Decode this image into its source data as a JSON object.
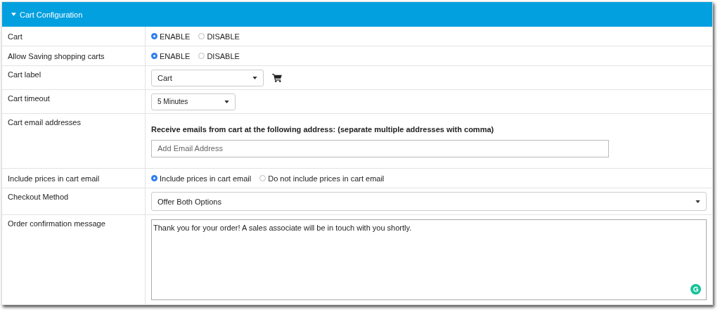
{
  "panel": {
    "title": "Cart Configuration",
    "expanded": true
  },
  "rows": [
    {
      "label": "Cart",
      "kind": "radio",
      "options": [
        {
          "label": "ENABLE",
          "selected": true
        },
        {
          "label": "DISABLE",
          "selected": false
        }
      ]
    },
    {
      "label": "Allow Saving shopping carts",
      "kind": "radio",
      "options": [
        {
          "label": "ENABLE",
          "selected": true
        },
        {
          "label": "DISABLE",
          "selected": false
        }
      ]
    },
    {
      "label": "Cart label",
      "kind": "select",
      "value": "Cart",
      "cart_icon": true
    },
    {
      "label": "Cart timeout",
      "kind": "select",
      "value": "5 Minutes"
    },
    {
      "label": "Cart email addresses",
      "kind": "email",
      "hint": "Receive emails from cart at the following address: (separate multiple addresses with comma)",
      "placeholder": "Add Email Address"
    },
    {
      "label": "Include prices in cart email",
      "kind": "radio",
      "options": [
        {
          "label": "Include prices in cart email",
          "selected": true
        },
        {
          "label": "Do not include prices in cart email",
          "selected": false
        }
      ]
    },
    {
      "label": "Checkout Method",
      "kind": "select",
      "value": "Offer Both Options"
    },
    {
      "label": "Order confirmation message",
      "kind": "textarea",
      "value": "Thank you for your order! A sales associate will be in touch with you shortly."
    }
  ]
}
